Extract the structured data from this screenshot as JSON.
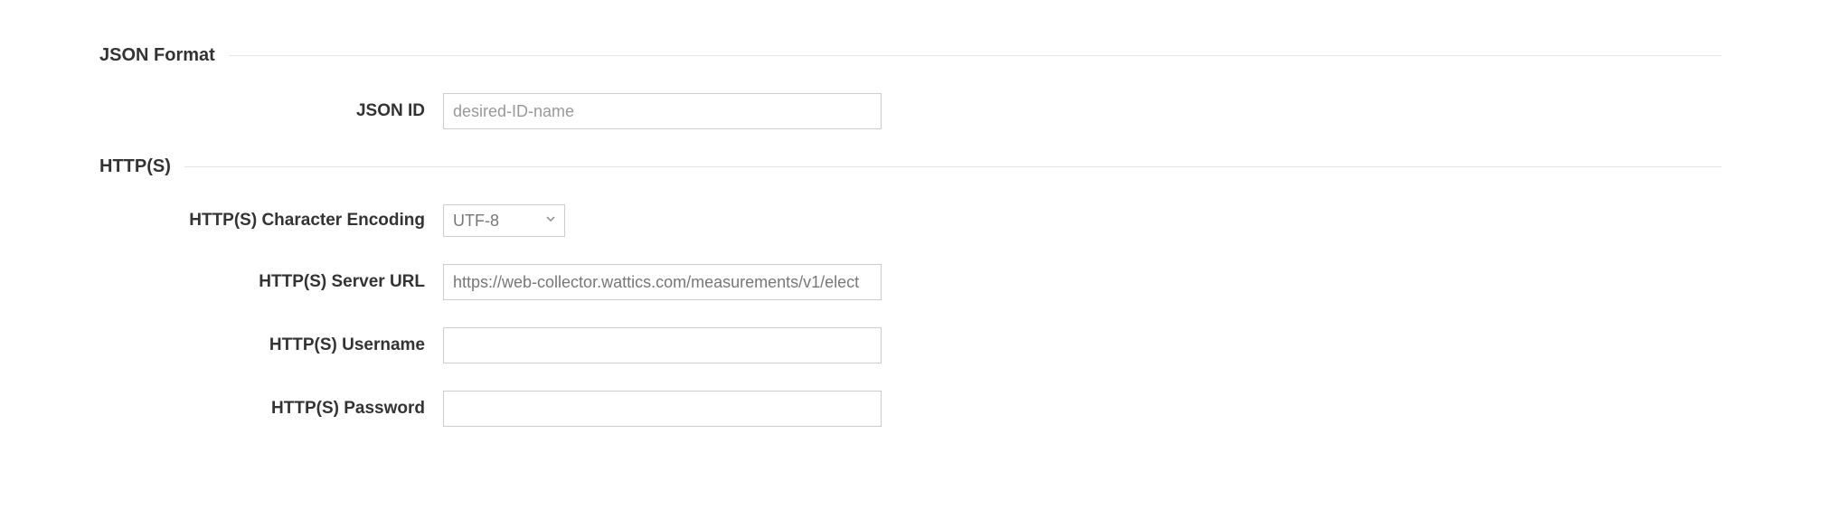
{
  "sections": {
    "json_format": {
      "title": "JSON Format",
      "json_id": {
        "label": "JSON ID",
        "placeholder": "desired-ID-name",
        "value": ""
      }
    },
    "https": {
      "title": "HTTP(S)",
      "encoding": {
        "label": "HTTP(S) Character Encoding",
        "value": "UTF-8"
      },
      "server_url": {
        "label": "HTTP(S) Server URL",
        "value": "https://web-collector.wattics.com/measurements/v1/elect"
      },
      "username": {
        "label": "HTTP(S) Username",
        "value": ""
      },
      "password": {
        "label": "HTTP(S) Password",
        "value": ""
      }
    }
  }
}
